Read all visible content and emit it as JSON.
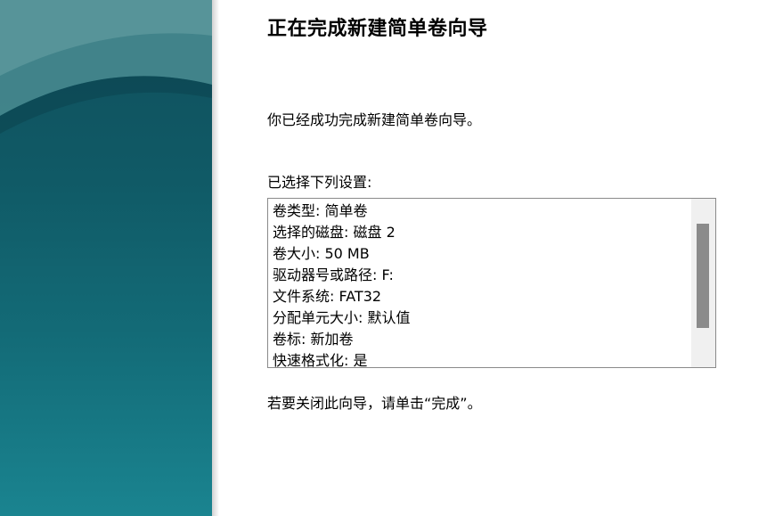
{
  "wizard": {
    "title": "正在完成新建简单卷向导",
    "message": "你已经成功完成新建简单卷向导。",
    "settings_label": "已选择下列设置:",
    "settings": [
      "卷类型: 简单卷",
      "选择的磁盘: 磁盘 2",
      "卷大小: 50 MB",
      "驱动器号或路径: F:",
      "文件系统: FAT32",
      "分配单元大小: 默认值",
      "卷标: 新加卷",
      "快速格式化: 是"
    ],
    "close_hint": "若要关闭此向导，请单击“完成”。"
  },
  "colors": {
    "banner_top": "#0f4f5c",
    "banner_bottom": "#1a8490",
    "scrollbar_thumb": "#8b8b8b",
    "scrollbar_track": "#f0f0f0"
  }
}
